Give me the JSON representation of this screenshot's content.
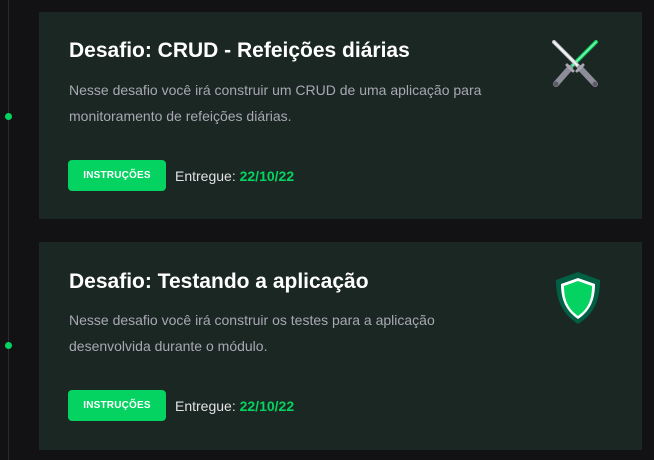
{
  "challenges": [
    {
      "title": "Desafio: CRUD - Refeições diárias",
      "description": "Nesse desafio você irá construir um CRUD de uma aplicação para monitoramento de refeições diárias.",
      "button_label": "INSTRUÇÕES",
      "delivered_label": "Entregue:",
      "delivered_date": "22/10/22",
      "icon": "crossed-lightsabers-icon"
    },
    {
      "title": "Desafio: Testando a aplicação",
      "description": "Nesse desafio você irá construir os testes para a aplicação desenvolvida durante o módulo.",
      "button_label": "INSTRUÇÕES",
      "delivered_label": "Entregue:",
      "delivered_date": "22/10/22",
      "icon": "shield-icon"
    }
  ],
  "colors": {
    "background": "#121214",
    "card": "#1b2723",
    "accent": "#04d361",
    "title": "#ffffff",
    "text": "#a8a8b3"
  }
}
